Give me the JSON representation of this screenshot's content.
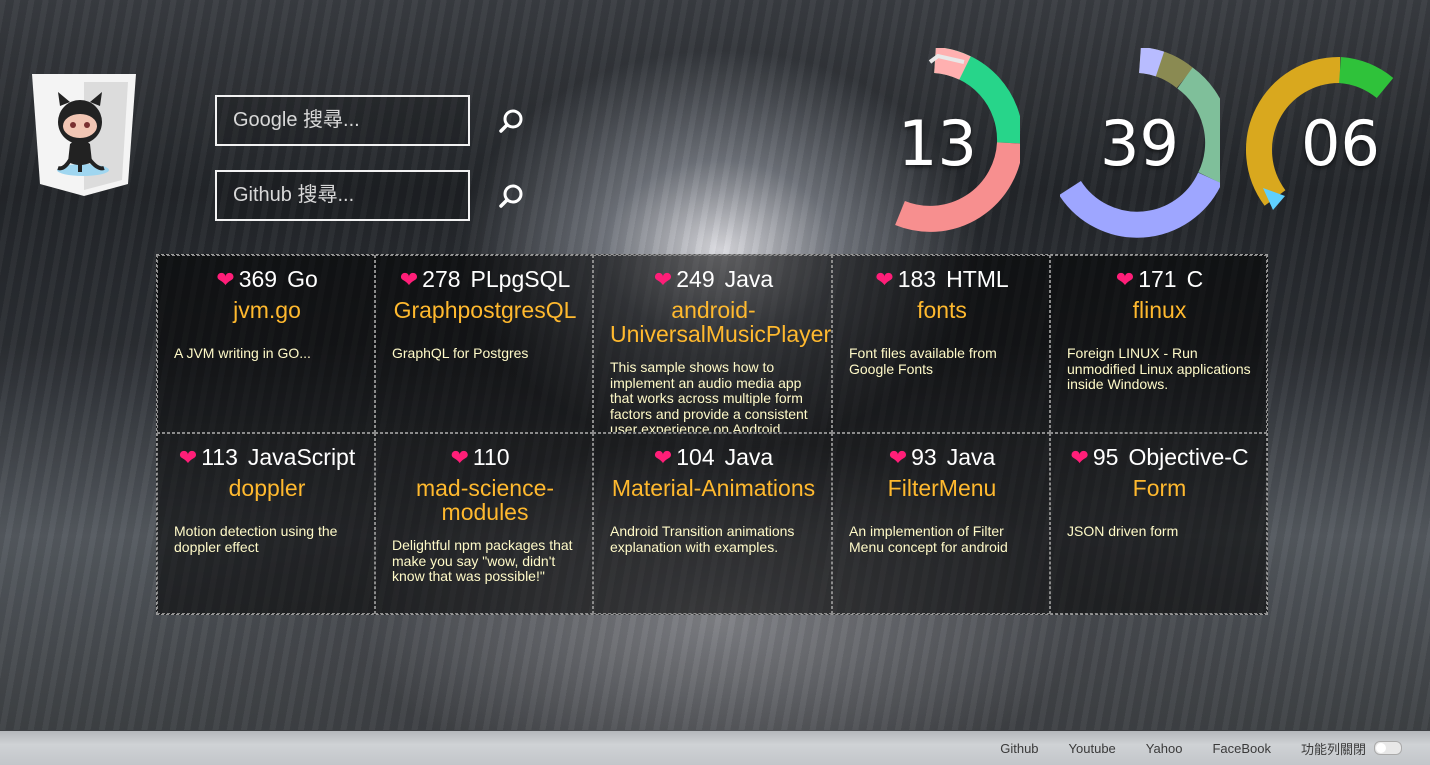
{
  "search": {
    "google_placeholder": "Google 搜尋...",
    "github_placeholder": "Github 搜尋..."
  },
  "clock": {
    "hours": "13",
    "minutes": "39",
    "seconds": "06"
  },
  "colors": {
    "star_heart": "#ff1e78",
    "repo_name": "#ffb92e",
    "description": "#fffac8"
  },
  "repos": [
    {
      "stars": "369",
      "lang": "Go",
      "name": "jvm.go",
      "desc": "A JVM writing in GO..."
    },
    {
      "stars": "278",
      "lang": "PLpgSQL",
      "name": "GraphpostgresQL",
      "desc": "GraphQL for Postgres"
    },
    {
      "stars": "249",
      "lang": "Java",
      "name": "android-UniversalMusicPlayer",
      "desc": "This sample shows how to implement an audio media app that works across multiple form factors and provide a consistent user experience on Android"
    },
    {
      "stars": "183",
      "lang": "HTML",
      "name": "fonts",
      "desc": "Font files available from Google Fonts"
    },
    {
      "stars": "171",
      "lang": "C",
      "name": "flinux",
      "desc": "Foreign LINUX - Run unmodified Linux applications inside Windows."
    },
    {
      "stars": "113",
      "lang": "JavaScript",
      "name": "doppler",
      "desc": "Motion detection using the doppler effect"
    },
    {
      "stars": "110",
      "lang": "",
      "name": "mad-science-modules",
      "desc": "Delightful npm packages that make you say \"wow, didn't know that was possible!\""
    },
    {
      "stars": "104",
      "lang": "Java",
      "name": "Material-Animations",
      "desc": "Android Transition animations explanation with examples."
    },
    {
      "stars": "93",
      "lang": "Java",
      "name": "FilterMenu",
      "desc": "An implemention of Filter Menu concept for android"
    },
    {
      "stars": "95",
      "lang": "Objective-C",
      "name": "Form",
      "desc": "JSON driven form"
    }
  ],
  "footer": {
    "links": [
      "Github",
      "Youtube",
      "Yahoo",
      "FaceBook"
    ],
    "toolbar_toggle_label": "功能列關閉"
  }
}
